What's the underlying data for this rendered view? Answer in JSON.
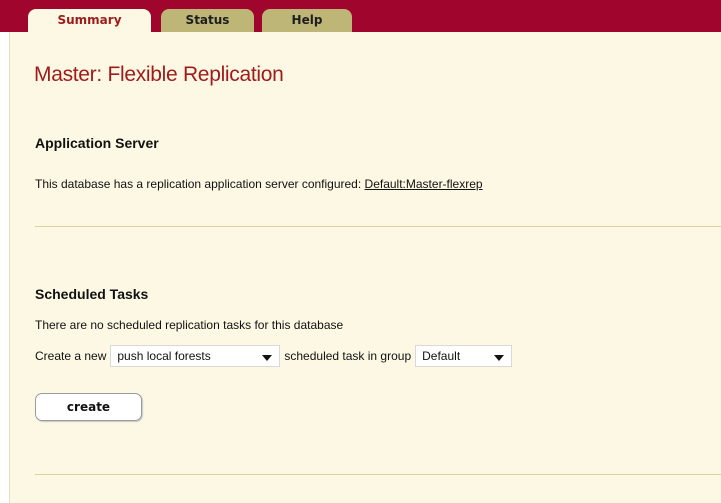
{
  "tabs": [
    {
      "label": "Summary",
      "active": true
    },
    {
      "label": "Status",
      "active": false
    },
    {
      "label": "Help",
      "active": false
    }
  ],
  "page_title": "Master: Flexible Replication",
  "app_server": {
    "heading": "Application Server",
    "text": "This database has a replication application server configured: ",
    "link_label": "Default:Master-flexrep"
  },
  "scheduled_tasks": {
    "heading": "Scheduled Tasks",
    "empty_text": "There are no scheduled replication tasks for this database",
    "create_prefix": "Create a new",
    "task_type_value": "push local forests",
    "middle_text": "scheduled task in group",
    "group_value": "Default",
    "create_button_label": "create"
  },
  "colors": {
    "tab_bar": "#a0062d",
    "background": "#fdf8e4",
    "title": "#9e1b1b",
    "inactive_tab": "#bdb676"
  }
}
